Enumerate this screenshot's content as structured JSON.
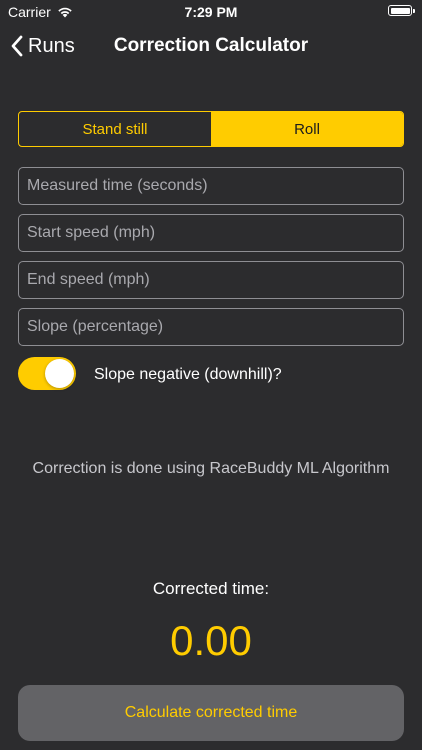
{
  "status_bar": {
    "carrier": "Carrier",
    "time": "7:29 PM",
    "wifi_icon": "wifi-icon",
    "battery_icon": "battery-icon"
  },
  "nav": {
    "back_label": "Runs",
    "back_icon": "chevron-left-icon",
    "title": "Correction Calculator"
  },
  "segments": {
    "items": [
      {
        "label": "Stand still",
        "selected": false
      },
      {
        "label": "Roll",
        "selected": true
      }
    ]
  },
  "fields": {
    "measured_time_placeholder": "Measured time (seconds)",
    "start_speed_placeholder": "Start speed (mph)",
    "end_speed_placeholder": "End speed (mph)",
    "slope_placeholder": "Slope (percentage)"
  },
  "toggle": {
    "label": "Slope negative (downhill)?",
    "on": true
  },
  "info_text": "Correction is done using RaceBuddy ML Algorithm",
  "result": {
    "label": "Corrected time:",
    "value": "0.00"
  },
  "calculate_button_label": "Calculate corrected time",
  "colors": {
    "background": "#2c2c2e",
    "accent": "#ffcc00",
    "button_bg": "#636366",
    "field_border": "#8e8e93"
  }
}
